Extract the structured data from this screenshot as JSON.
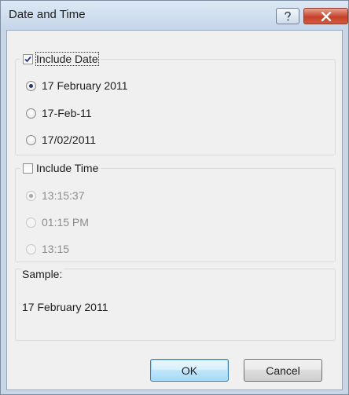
{
  "window": {
    "title": "Date and Time",
    "help_glyph": "?",
    "close_glyph": "✕"
  },
  "date_group": {
    "checkbox_label": "Include Date",
    "checked": true,
    "options": [
      {
        "label": "17 February 2011",
        "selected": true
      },
      {
        "label": "17-Feb-11",
        "selected": false
      },
      {
        "label": "17/02/2011",
        "selected": false
      }
    ]
  },
  "time_group": {
    "checkbox_label": "Include Time",
    "checked": false,
    "options": [
      {
        "label": "13:15:37",
        "selected": true
      },
      {
        "label": "01:15 PM",
        "selected": false
      },
      {
        "label": "13:15",
        "selected": false
      }
    ]
  },
  "sample": {
    "label": "Sample:",
    "value": "17 February 2011"
  },
  "buttons": {
    "ok": "OK",
    "cancel": "Cancel"
  },
  "colors": {
    "title_bar": "#c6d6ea",
    "dialog_bg": "#f0f0f0",
    "close_button": "#c6422a",
    "default_button_border": "#3c7fb1",
    "disabled_text": "#8c8c8c"
  }
}
